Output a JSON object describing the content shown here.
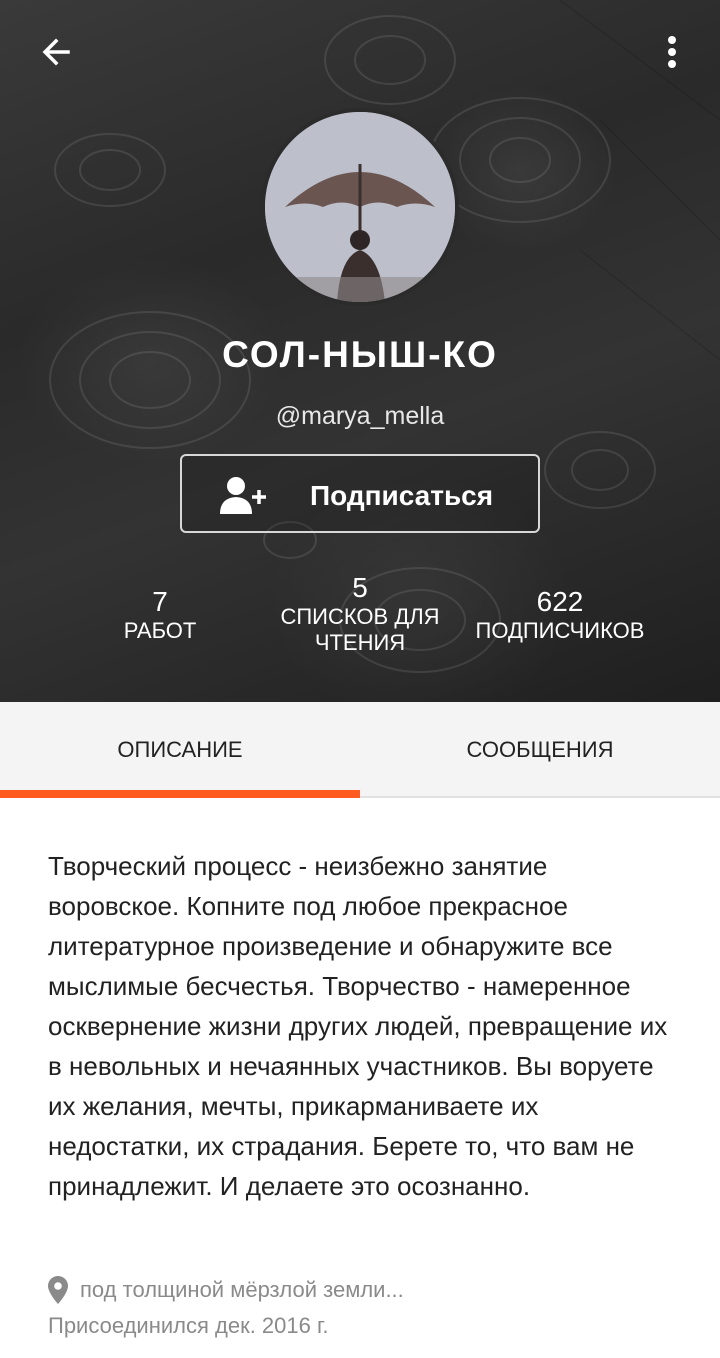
{
  "header": {
    "back_icon": "arrow-left-icon",
    "menu_icon": "more-vertical-icon"
  },
  "profile": {
    "display_name": "СОЛ-НЫШ-КО",
    "username": "@marya_mella",
    "follow_label": "Подписаться",
    "follow_icon": "add-user-icon"
  },
  "stats": [
    {
      "value": "7",
      "label": "РАБОТ"
    },
    {
      "value": "5",
      "label": "СПИСКОВ ДЛЯ ЧТЕНИЯ"
    },
    {
      "value": "622",
      "label": "ПОДПИСЧИКОВ"
    }
  ],
  "tabs": [
    {
      "label": "ОПИСАНИЕ",
      "active": true
    },
    {
      "label": "СООБЩЕНИЯ",
      "active": false
    }
  ],
  "about": {
    "description": "Творческий процесс - неизбежно занятие воровское. Копните под любое прекрасное литературное произведение и обнаружите все мыслимые бесчестья. Творчество - намеренное осквернение жизни других людей, превращение их в невольных и нечаянных участников. Вы воруете их желания, мечты, прикарманиваете их недостатки, их страдания. Берете то, что вам не принадлежит. И делаете это осознанно.",
    "location": "под толщиной мёрзлой земли...",
    "location_icon": "location-pin-icon",
    "joined": "Присоединился дек. 2016 г."
  },
  "colors": {
    "accent": "#ff5a1f",
    "hero_bg": "#2e2e2e",
    "muted_text": "#8a8a8a"
  }
}
